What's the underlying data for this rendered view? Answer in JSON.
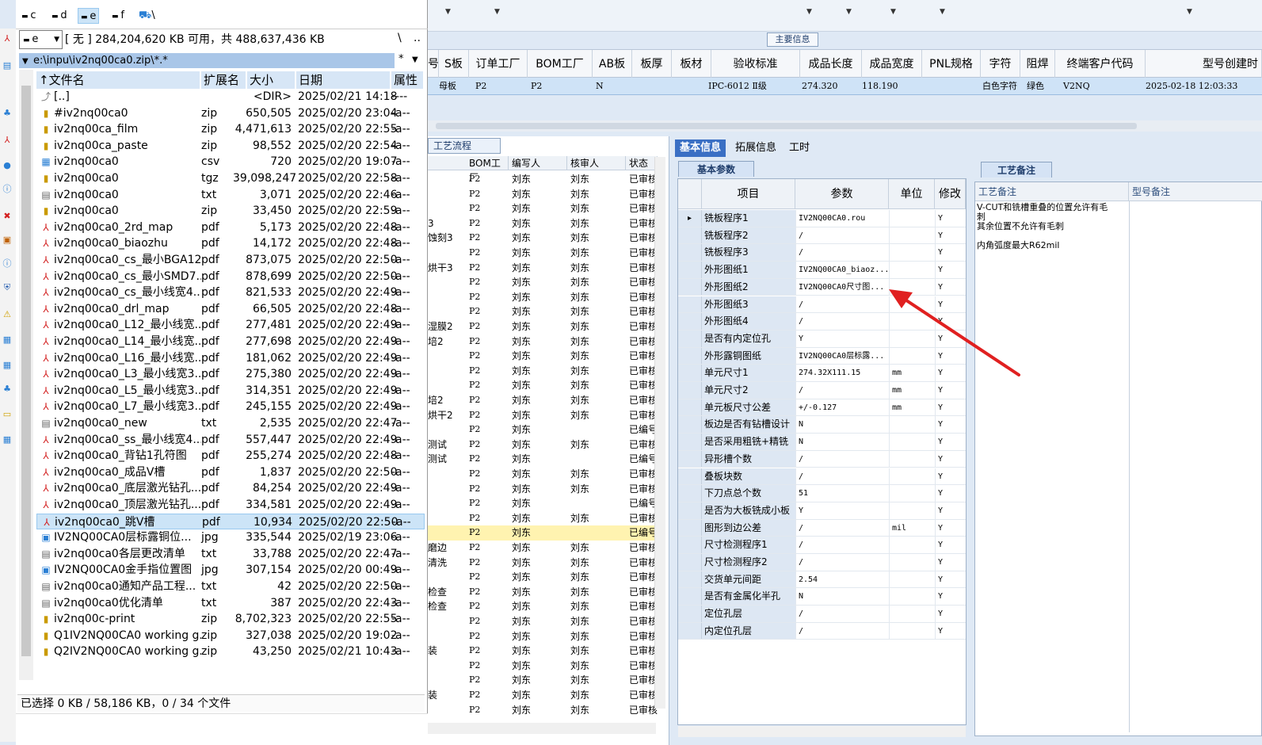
{
  "erp": {
    "main_info_label": "主要信息",
    "grid_columns": [
      "号",
      "S板",
      "订单工厂",
      "BOM工厂",
      "AB板",
      "板厚",
      "板材",
      "验收标准",
      "成品长度",
      "成品宽度",
      "PNL规格",
      "字符",
      "阻焊",
      "终端客户代码",
      "型号创建时"
    ],
    "grid_row": {
      "s": "母板",
      "order": "P2",
      "bom": "P2",
      "ab": "N",
      "std": "IPC-6012 Ⅱ级",
      "len": "274.320",
      "wid": "118.190",
      "char": "白色字符",
      "mask": "绿色",
      "cust": "V2NQ",
      "time": "2025-02-18 12:03:33"
    }
  },
  "process": {
    "tab_label": "工艺流程",
    "columns": [
      "BOM工厂",
      "编写人",
      "核审人",
      "状态"
    ],
    "rows": [
      {
        "pre": "",
        "bom": "P2",
        "w": "刘东",
        "r": "刘东",
        "st": "已审核"
      },
      {
        "pre": "",
        "bom": "P2",
        "w": "刘东",
        "r": "刘东",
        "st": "已审核"
      },
      {
        "pre": "",
        "bom": "P2",
        "w": "刘东",
        "r": "刘东",
        "st": "已审核"
      },
      {
        "pre": "3",
        "bom": "P2",
        "w": "刘东",
        "r": "刘东",
        "st": "已审核"
      },
      {
        "pre": "蚀刻3",
        "bom": "P2",
        "w": "刘东",
        "r": "刘东",
        "st": "已审核"
      },
      {
        "pre": "",
        "bom": "P2",
        "w": "刘东",
        "r": "刘东",
        "st": "已审核"
      },
      {
        "pre": "烘干3",
        "bom": "P2",
        "w": "刘东",
        "r": "刘东",
        "st": "已审核"
      },
      {
        "pre": "",
        "bom": "P2",
        "w": "刘东",
        "r": "刘东",
        "st": "已审核"
      },
      {
        "pre": "",
        "bom": "P2",
        "w": "刘东",
        "r": "刘东",
        "st": "已审核"
      },
      {
        "pre": "",
        "bom": "P2",
        "w": "刘东",
        "r": "刘东",
        "st": "已审核"
      },
      {
        "pre": "湿膜2",
        "bom": "P2",
        "w": "刘东",
        "r": "刘东",
        "st": "已审核"
      },
      {
        "pre": "培2",
        "bom": "P2",
        "w": "刘东",
        "r": "刘东",
        "st": "已审核"
      },
      {
        "pre": "",
        "bom": "P2",
        "w": "刘东",
        "r": "刘东",
        "st": "已审核"
      },
      {
        "pre": "",
        "bom": "P2",
        "w": "刘东",
        "r": "刘东",
        "st": "已审核"
      },
      {
        "pre": "",
        "bom": "P2",
        "w": "刘东",
        "r": "刘东",
        "st": "已审核"
      },
      {
        "pre": "培2",
        "bom": "P2",
        "w": "刘东",
        "r": "刘东",
        "st": "已审核"
      },
      {
        "pre": "烘干2",
        "bom": "P2",
        "w": "刘东",
        "r": "刘东",
        "st": "已审核"
      },
      {
        "pre": "",
        "bom": "P2",
        "w": "刘东",
        "r": "",
        "st": "已编号"
      },
      {
        "pre": "测试",
        "bom": "P2",
        "w": "刘东",
        "r": "刘东",
        "st": "已审核"
      },
      {
        "pre": "测试",
        "bom": "P2",
        "w": "刘东",
        "r": "",
        "st": "已编号"
      },
      {
        "pre": "",
        "bom": "P2",
        "w": "刘东",
        "r": "刘东",
        "st": "已审核"
      },
      {
        "pre": "",
        "bom": "P2",
        "w": "刘东",
        "r": "刘东",
        "st": "已审核"
      },
      {
        "pre": "",
        "bom": "P2",
        "w": "刘东",
        "r": "",
        "st": "已编号"
      },
      {
        "pre": "",
        "bom": "P2",
        "w": "刘东",
        "r": "刘东",
        "st": "已审核"
      },
      {
        "pre": "",
        "bom": "P2",
        "w": "刘东",
        "r": "",
        "st": "已编号"
      },
      {
        "pre": "磨边",
        "bom": "P2",
        "w": "刘东",
        "r": "刘东",
        "st": "已审核"
      },
      {
        "pre": "清洗",
        "bom": "P2",
        "w": "刘东",
        "r": "刘东",
        "st": "已审核"
      },
      {
        "pre": "",
        "bom": "P2",
        "w": "刘东",
        "r": "刘东",
        "st": "已审核"
      },
      {
        "pre": "检查",
        "bom": "P2",
        "w": "刘东",
        "r": "刘东",
        "st": "已审核"
      },
      {
        "pre": "检查",
        "bom": "P2",
        "w": "刘东",
        "r": "刘东",
        "st": "已审核"
      },
      {
        "pre": "",
        "bom": "P2",
        "w": "刘东",
        "r": "刘东",
        "st": "已审核"
      },
      {
        "pre": "",
        "bom": "P2",
        "w": "刘东",
        "r": "刘东",
        "st": "已审核"
      },
      {
        "pre": "装",
        "bom": "P2",
        "w": "刘东",
        "r": "刘东",
        "st": "已审核"
      },
      {
        "pre": "",
        "bom": "P2",
        "w": "刘东",
        "r": "刘东",
        "st": "已审核"
      },
      {
        "pre": "",
        "bom": "P2",
        "w": "刘东",
        "r": "刘东",
        "st": "已审核"
      },
      {
        "pre": "装",
        "bom": "P2",
        "w": "刘东",
        "r": "刘东",
        "st": "已审核"
      },
      {
        "pre": "",
        "bom": "P2",
        "w": "刘东",
        "r": "刘东",
        "st": "已审核"
      }
    ]
  },
  "info": {
    "tabs": [
      "基本信息",
      "拓展信息",
      "工时"
    ],
    "section": "基本参数",
    "columns": [
      "项目",
      "参数",
      "单位",
      "修改"
    ],
    "rows": [
      {
        "k": "铣板程序1",
        "v": "IV2NQ00CA0.rou",
        "u": "",
        "m": "Y"
      },
      {
        "k": "铣板程序2",
        "v": "/",
        "u": "",
        "m": "Y"
      },
      {
        "k": "铣板程序3",
        "v": "/",
        "u": "",
        "m": "Y"
      },
      {
        "k": "外形图纸1",
        "v": "IV2NQ00CA0_biaoz...",
        "u": "",
        "m": "Y"
      },
      {
        "k": "外形图纸2",
        "v": "IV2NQ00CA0尺寸图...",
        "u": "",
        "m": "Y"
      },
      {
        "k": "外形图纸3",
        "v": "/",
        "u": "",
        "m": "Y"
      },
      {
        "k": "外形图纸4",
        "v": "/",
        "u": "",
        "m": "Y"
      },
      {
        "k": "是否有内定位孔",
        "v": "Y",
        "u": "",
        "m": "Y"
      },
      {
        "k": "外形露铜图纸",
        "v": "IV2NQ00CA0层标露...",
        "u": "",
        "m": "Y"
      },
      {
        "k": "单元尺寸1",
        "v": "274.32X111.15",
        "u": "mm",
        "m": "Y"
      },
      {
        "k": "单元尺寸2",
        "v": "/",
        "u": "mm",
        "m": "Y"
      },
      {
        "k": "单元板尺寸公差",
        "v": "+/-0.127",
        "u": "mm",
        "m": "Y"
      },
      {
        "k": "板边是否有钻槽设计",
        "v": "N",
        "u": "",
        "m": "Y"
      },
      {
        "k": "是否采用粗铣+精铣",
        "v": "N",
        "u": "",
        "m": "Y"
      },
      {
        "k": "异形槽个数",
        "v": "/",
        "u": "",
        "m": "Y"
      },
      {
        "k": "叠板块数",
        "v": "/",
        "u": "",
        "m": "Y"
      },
      {
        "k": "下刀点总个数",
        "v": "51",
        "u": "",
        "m": "Y"
      },
      {
        "k": "是否为大板铣成小板",
        "v": "Y",
        "u": "",
        "m": "Y"
      },
      {
        "k": "图形到边公差",
        "v": "/",
        "u": "mil",
        "m": "Y"
      },
      {
        "k": "尺寸检测程序1",
        "v": "/",
        "u": "",
        "m": "Y"
      },
      {
        "k": "尺寸检测程序2",
        "v": "/",
        "u": "",
        "m": "Y"
      },
      {
        "k": "交货单元间距",
        "v": "2.54",
        "u": "",
        "m": "Y"
      },
      {
        "k": "是否有金属化半孔",
        "v": "N",
        "u": "",
        "m": "Y"
      },
      {
        "k": "定位孔层",
        "v": "/",
        "u": "",
        "m": "Y"
      },
      {
        "k": "内定位孔层",
        "v": "/",
        "u": "",
        "m": "Y"
      }
    ]
  },
  "remarks": {
    "tab": "工艺备注",
    "col1": "工艺备注",
    "col2": "型号备注",
    "lines": [
      "V-CUT和铣槽重叠的位置允许有毛",
      "刺",
      "其余位置不允许有毛刺",
      "",
      "内角弧度最大R62mil"
    ]
  },
  "filemgr": {
    "drives": [
      "c",
      "d",
      "e",
      "f",
      "\\"
    ],
    "drive_selected": "e",
    "drive_info": "[ 无 ]  284,204,620 KB 可用，共 488,637,436 KB",
    "path_root": "\\",
    "path_up": "..",
    "current_path": "e:\\inpu\\iv2nq00ca0.zip\\*.*",
    "path_filter": "*",
    "columns": [
      "↑文件名",
      "扩展名",
      "大小",
      "日期",
      "属性"
    ],
    "files": [
      {
        "i": "up",
        "n": "[..]",
        "e": "",
        "s": "<DIR>",
        "d": "2025/02/21 14:18",
        "a": "----"
      },
      {
        "i": "zip",
        "n": "#iv2nq00ca0",
        "e": "zip",
        "s": "650,505",
        "d": "2025/02/20 23:04",
        "a": "-a--"
      },
      {
        "i": "zip",
        "n": "iv2nq00ca_film",
        "e": "zip",
        "s": "4,471,613",
        "d": "2025/02/20 22:55",
        "a": "-a--"
      },
      {
        "i": "zip",
        "n": "iv2nq00ca_paste",
        "e": "zip",
        "s": "98,552",
        "d": "2025/02/20 22:54",
        "a": "-a--"
      },
      {
        "i": "csv",
        "n": "iv2nq00ca0",
        "e": "csv",
        "s": "720",
        "d": "2025/02/20 19:07",
        "a": "-a--"
      },
      {
        "i": "zip",
        "n": "iv2nq00ca0",
        "e": "tgz",
        "s": "39,098,247",
        "d": "2025/02/20 22:58",
        "a": "-a--"
      },
      {
        "i": "txt",
        "n": "iv2nq00ca0",
        "e": "txt",
        "s": "3,071",
        "d": "2025/02/20 22:46",
        "a": "-a--"
      },
      {
        "i": "zip",
        "n": "iv2nq00ca0",
        "e": "zip",
        "s": "33,450",
        "d": "2025/02/20 22:59",
        "a": "-a--"
      },
      {
        "i": "pdf",
        "n": "iv2nq00ca0_2rd_map",
        "e": "pdf",
        "s": "5,173",
        "d": "2025/02/20 22:48",
        "a": "-a--"
      },
      {
        "i": "pdf",
        "n": "iv2nq00ca0_biaozhu",
        "e": "pdf",
        "s": "14,172",
        "d": "2025/02/20 22:48",
        "a": "-a--"
      },
      {
        "i": "pdf",
        "n": "iv2nq00ca0_cs_最小BGA12...",
        "e": "pdf",
        "s": "873,075",
        "d": "2025/02/20 22:50",
        "a": "-a--"
      },
      {
        "i": "pdf",
        "n": "iv2nq00ca0_cs_最小SMD7...",
        "e": "pdf",
        "s": "878,699",
        "d": "2025/02/20 22:50",
        "a": "-a--"
      },
      {
        "i": "pdf",
        "n": "iv2nq00ca0_cs_最小线宽4...",
        "e": "pdf",
        "s": "821,533",
        "d": "2025/02/20 22:49",
        "a": "-a--"
      },
      {
        "i": "pdf",
        "n": "iv2nq00ca0_drl_map",
        "e": "pdf",
        "s": "66,505",
        "d": "2025/02/20 22:48",
        "a": "-a--"
      },
      {
        "i": "pdf",
        "n": "iv2nq00ca0_L12_最小线宽...",
        "e": "pdf",
        "s": "277,481",
        "d": "2025/02/20 22:49",
        "a": "-a--"
      },
      {
        "i": "pdf",
        "n": "iv2nq00ca0_L14_最小线宽...",
        "e": "pdf",
        "s": "277,698",
        "d": "2025/02/20 22:49",
        "a": "-a--"
      },
      {
        "i": "pdf",
        "n": "iv2nq00ca0_L16_最小线宽...",
        "e": "pdf",
        "s": "181,062",
        "d": "2025/02/20 22:49",
        "a": "-a--"
      },
      {
        "i": "pdf",
        "n": "iv2nq00ca0_L3_最小线宽3...",
        "e": "pdf",
        "s": "275,380",
        "d": "2025/02/20 22:49",
        "a": "-a--"
      },
      {
        "i": "pdf",
        "n": "iv2nq00ca0_L5_最小线宽3...",
        "e": "pdf",
        "s": "314,351",
        "d": "2025/02/20 22:49",
        "a": "-a--"
      },
      {
        "i": "pdf",
        "n": "iv2nq00ca0_L7_最小线宽3...",
        "e": "pdf",
        "s": "245,155",
        "d": "2025/02/20 22:49",
        "a": "-a--"
      },
      {
        "i": "txt",
        "n": "iv2nq00ca0_new",
        "e": "txt",
        "s": "2,535",
        "d": "2025/02/20 22:47",
        "a": "-a--"
      },
      {
        "i": "pdf",
        "n": "iv2nq00ca0_ss_最小线宽4...",
        "e": "pdf",
        "s": "557,447",
        "d": "2025/02/20 22:49",
        "a": "-a--"
      },
      {
        "i": "pdf",
        "n": "iv2nq00ca0_背钻1孔符图",
        "e": "pdf",
        "s": "255,274",
        "d": "2025/02/20 22:48",
        "a": "-a--"
      },
      {
        "i": "pdf",
        "n": "iv2nq00ca0_成品V槽",
        "e": "pdf",
        "s": "1,837",
        "d": "2025/02/20 22:50",
        "a": "-a--"
      },
      {
        "i": "pdf",
        "n": "iv2nq00ca0_底层激光钻孔...",
        "e": "pdf",
        "s": "84,254",
        "d": "2025/02/20 22:49",
        "a": "-a--"
      },
      {
        "i": "pdf",
        "n": "iv2nq00ca0_顶层激光钻孔...",
        "e": "pdf",
        "s": "334,581",
        "d": "2025/02/20 22:49",
        "a": "-a--"
      },
      {
        "i": "pdf",
        "n": "iv2nq00ca0_跳V槽",
        "e": "pdf",
        "s": "10,934",
        "d": "2025/02/20 22:50",
        "a": "-a--"
      },
      {
        "i": "img",
        "n": "IV2NQ00CA0层标露铜位...",
        "e": "jpg",
        "s": "335,544",
        "d": "2025/02/19 23:06",
        "a": "-a--"
      },
      {
        "i": "txt",
        "n": "iv2nq00ca0各层更改清单",
        "e": "txt",
        "s": "33,788",
        "d": "2025/02/20 22:47",
        "a": "-a--"
      },
      {
        "i": "img",
        "n": "IV2NQ00CA0金手指位置图",
        "e": "jpg",
        "s": "307,154",
        "d": "2025/02/20 00:49",
        "a": "-a--"
      },
      {
        "i": "txt",
        "n": "iv2nq00ca0通知产品工程...",
        "e": "txt",
        "s": "42",
        "d": "2025/02/20 22:50",
        "a": "-a--"
      },
      {
        "i": "txt",
        "n": "iv2nq00ca0优化清单",
        "e": "txt",
        "s": "387",
        "d": "2025/02/20 22:43",
        "a": "-a--"
      },
      {
        "i": "zip",
        "n": "iv2nq00c-print",
        "e": "zip",
        "s": "8,702,323",
        "d": "2025/02/20 22:55",
        "a": "-a--"
      },
      {
        "i": "zip",
        "n": "Q1IV2NQ00CA0 working g...",
        "e": "zip",
        "s": "327,038",
        "d": "2025/02/20 19:02",
        "a": "-a--"
      },
      {
        "i": "zip",
        "n": "Q2IV2NQ00CA0 working g...",
        "e": "zip",
        "s": "43,250",
        "d": "2025/02/21 10:43",
        "a": "-a--"
      }
    ],
    "selected_index": 26,
    "status": "已选择 0 KB / 58,186 KB，0 / 34 个文件"
  }
}
